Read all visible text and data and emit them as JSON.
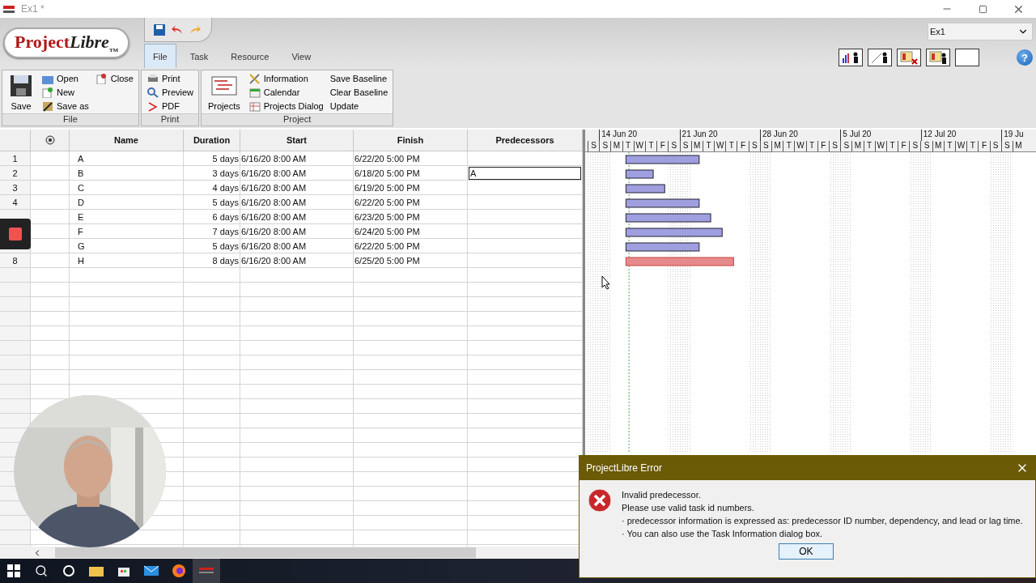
{
  "window": {
    "title": "Ex1 *"
  },
  "logo": {
    "text": "Project",
    "suffix": "Libre",
    "mark": "TM"
  },
  "ribbon": {
    "tabs": [
      {
        "label": "File",
        "selected": true
      },
      {
        "label": "Task",
        "selected": false
      },
      {
        "label": "Resource",
        "selected": false
      },
      {
        "label": "View",
        "selected": false
      }
    ],
    "project_select": {
      "value": "Ex1"
    },
    "help": "?",
    "groups": [
      {
        "label": "File",
        "columns": [
          [
            {
              "label": "Save",
              "kind": "large"
            }
          ],
          [
            {
              "label": "Open",
              "kind": "small"
            },
            {
              "label": "New",
              "kind": "small"
            },
            {
              "label": "Save as",
              "kind": "small"
            }
          ],
          [
            {
              "label": "Close",
              "kind": "small"
            }
          ]
        ]
      },
      {
        "label": "Print",
        "columns": [
          [
            {
              "label": "Print",
              "kind": "small"
            },
            {
              "label": "Preview",
              "kind": "small"
            },
            {
              "label": "PDF",
              "kind": "small"
            }
          ]
        ]
      },
      {
        "label": "Project",
        "columns": [
          [
            {
              "label": "Projects",
              "kind": "large"
            }
          ],
          [
            {
              "label": "Information",
              "kind": "small"
            },
            {
              "label": "Calendar",
              "kind": "small"
            },
            {
              "label": "Projects Dialog",
              "kind": "small"
            }
          ],
          [
            {
              "label": "Save Baseline",
              "kind": "text"
            },
            {
              "label": "Clear Baseline",
              "kind": "text"
            },
            {
              "label": "Update",
              "kind": "text"
            }
          ]
        ]
      }
    ]
  },
  "table": {
    "columns": [
      "Name",
      "Duration",
      "Start",
      "Finish",
      "Predecessors"
    ],
    "rows": [
      {
        "id": "1",
        "name": "A",
        "duration": "5 days",
        "start": "6/16/20 8:00 AM",
        "finish": "6/22/20 5:00 PM",
        "predecessors": "",
        "editing": false,
        "critical": false
      },
      {
        "id": "2",
        "name": "B",
        "duration": "3 days",
        "start": "6/16/20 8:00 AM",
        "finish": "6/18/20 5:00 PM",
        "predecessors": "A",
        "editing": true,
        "critical": false
      },
      {
        "id": "3",
        "name": "C",
        "duration": "4 days",
        "start": "6/16/20 8:00 AM",
        "finish": "6/19/20 5:00 PM",
        "predecessors": "",
        "editing": false,
        "critical": false
      },
      {
        "id": "4",
        "name": "D",
        "duration": "5 days",
        "start": "6/16/20 8:00 AM",
        "finish": "6/22/20 5:00 PM",
        "predecessors": "",
        "editing": false,
        "critical": false
      },
      {
        "name": "E",
        "duration": "6 days",
        "start": "6/16/20 8:00 AM",
        "finish": "6/23/20 5:00 PM",
        "predecessors": "",
        "editing": false,
        "critical": false
      },
      {
        "name": "F",
        "duration": "7 days",
        "start": "6/16/20 8:00 AM",
        "finish": "6/24/20 5:00 PM",
        "predecessors": "",
        "editing": false,
        "critical": false
      },
      {
        "name": "G",
        "duration": "5 days",
        "start": "6/16/20 8:00 AM",
        "finish": "6/22/20 5:00 PM",
        "predecessors": "",
        "editing": false,
        "critical": false
      },
      {
        "id": "8",
        "name": "H",
        "duration": "8 days",
        "start": "6/16/20 8:00 AM",
        "finish": "6/25/20 5:00 PM",
        "predecessors": "",
        "editing": false,
        "critical": true
      }
    ]
  },
  "gantt": {
    "weeks": [
      "14 Jun 20",
      "21 Jun 20",
      "28 Jun 20",
      "5 Jul 20",
      "12 Jul 20",
      "19 Ju"
    ],
    "days": [
      "S",
      "S",
      "M",
      "T",
      "W",
      "T",
      "F",
      "S",
      "S",
      "M",
      "T",
      "W",
      "T",
      "F",
      "S",
      "S",
      "M",
      "T",
      "W",
      "T",
      "F",
      "S",
      "S",
      "M",
      "T",
      "W",
      "T",
      "F",
      "S",
      "S",
      "M",
      "T",
      "W",
      "T",
      "F",
      "S",
      "S",
      "M"
    ]
  },
  "dialog": {
    "title": "ProjectLibre Error",
    "lines": [
      "Invalid predecessor.",
      "Please use valid task id numbers.",
      "· predecessor information is expressed as: predecessor ID number, dependency, and lead or lag time.",
      "· You can also use the Task Information dialog box."
    ],
    "button": "OK"
  }
}
